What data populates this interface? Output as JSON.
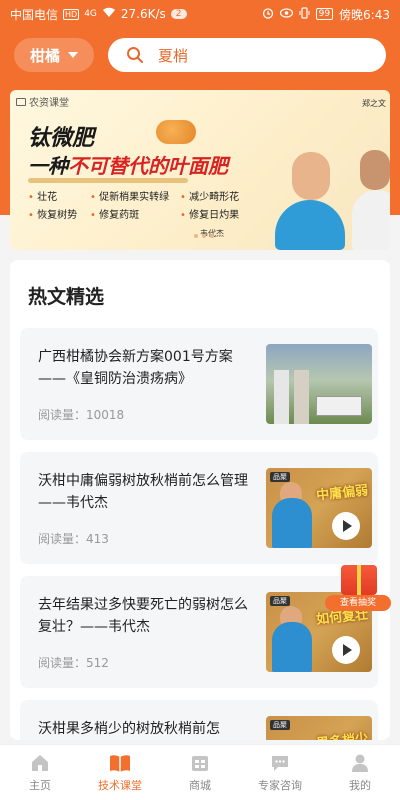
{
  "status_bar": {
    "carrier": "中国电信",
    "hd": "HD",
    "signal": "4G",
    "speed": "27.6K/s",
    "notif_count": "2",
    "battery": "99",
    "time": "傍晚6:43"
  },
  "header": {
    "region": "柑橘",
    "search_placeholder": "夏梢"
  },
  "banner": {
    "tag": "农资课堂",
    "title_line1": "钛微肥",
    "title_line2_prefix": "一种",
    "title_line2_highlight": "不可替代的叶面肥",
    "benefits": [
      "壮花",
      "促新梢果实转绿",
      "减少畸形花",
      "恢复树势",
      "修复药斑",
      "修复日灼果"
    ],
    "expert1": "郑之文",
    "expert2": "韦代杰"
  },
  "section": {
    "title": "热文精选"
  },
  "articles": [
    {
      "title": "广西柑橘协会新方案001号方案——《皇铜防治溃疡病》",
      "reads": "阅读量：10018"
    },
    {
      "title": "沃柑中庸偏弱树放秋梢前怎么管理——韦代杰",
      "reads": "阅读量：413",
      "thumb_text": "中庸偏弱"
    },
    {
      "title": "去年结果过多快要死亡的弱树怎么复壮？——韦代杰",
      "reads": "阅读量：512",
      "thumb_text": "如何复壮"
    },
    {
      "title": "沃柑果多梢少的树放秋梢前怎",
      "reads": "",
      "thumb_text": "果多梢少"
    }
  ],
  "thumb_tag": "品聚",
  "gift_label": "查看抽奖",
  "tabs": [
    {
      "label": "主页",
      "icon": "home-icon"
    },
    {
      "label": "技术课堂",
      "icon": "book-icon"
    },
    {
      "label": "商城",
      "icon": "shop-icon"
    },
    {
      "label": "专家咨询",
      "icon": "chat-icon"
    },
    {
      "label": "我的",
      "icon": "profile-icon"
    }
  ],
  "colors": {
    "primary": "#f26f2e",
    "highlight_red": "#d82323"
  }
}
